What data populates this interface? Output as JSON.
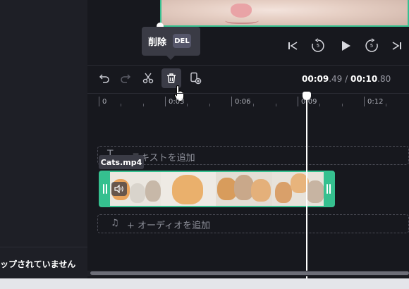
{
  "left_panel": {
    "status_text": "ップされていません"
  },
  "player": {
    "seek_back_seconds": "5",
    "seek_fwd_seconds": "5"
  },
  "tooltip": {
    "label": "削除",
    "shortcut": "DEL"
  },
  "timecode": {
    "current_main": "00:09",
    "current_frac": ".49",
    "separator": " / ",
    "total_main": "00:10",
    "total_frac": ".80"
  },
  "ruler": {
    "labels": [
      "0",
      "0:03",
      "0:06",
      "0:09",
      "0:12"
    ]
  },
  "tracks": {
    "text_placeholder": "テキストを追加",
    "audio_placeholder": "+ オーディオを追加",
    "clip_name": "Cats.mp4"
  },
  "icons": {
    "collapse": "chevron-left-icon",
    "skip_start": "skip-to-start-icon",
    "rewind": "rewind-5-icon",
    "play": "play-icon",
    "forward": "forward-5-icon",
    "skip_end": "skip-to-end-icon",
    "undo": "undo-icon",
    "redo": "redo-icon",
    "cut": "scissors-icon",
    "delete": "trash-icon",
    "duplicate": "duplicate-icon",
    "volume": "volume-icon",
    "text": "text-icon",
    "music": "music-note-icon"
  },
  "colors": {
    "accent": "#35c08f",
    "background": "#17181e",
    "panel": "#1e1f26"
  }
}
